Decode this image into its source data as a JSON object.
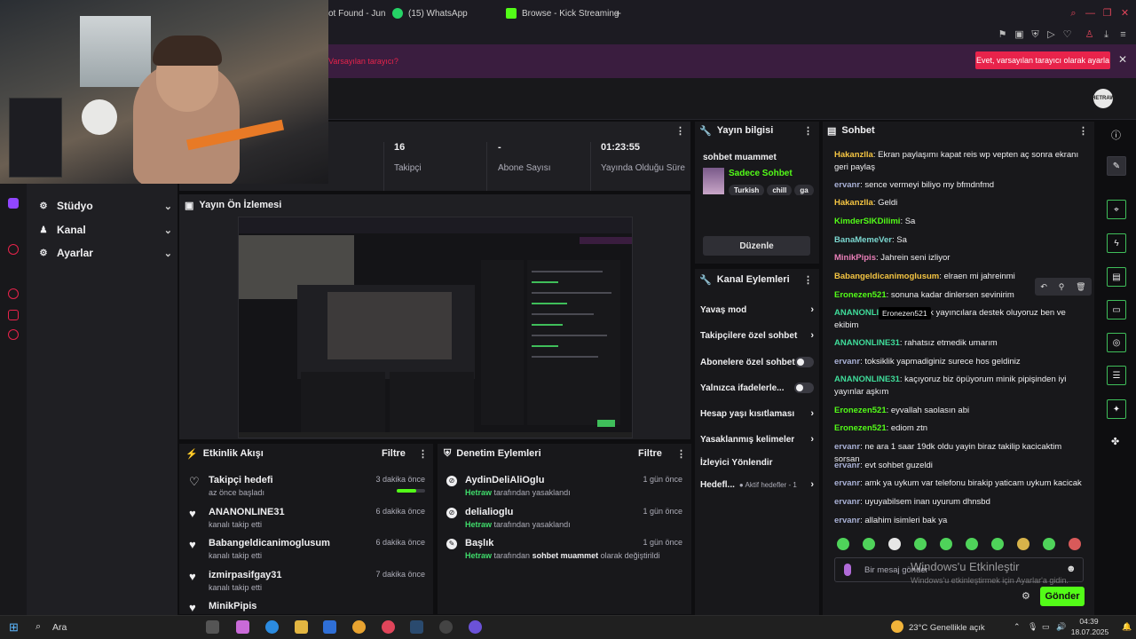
{
  "browser": {
    "tabs": [
      {
        "label": "ot Found - Jun",
        "icon": "page-icon"
      },
      {
        "label": "(15) WhatsApp",
        "icon": "whatsapp-icon"
      },
      {
        "label": "Browse - Kick Streaming",
        "icon": "kick-icon"
      }
    ],
    "new_tab": "+",
    "notify_text": "Varsayılan tarayıcı?",
    "notify_button": "Evet, varsayılan tarayıcı olarak ayarla",
    "notify_close": "✕"
  },
  "header": {
    "avatar_text": "HETRAW"
  },
  "nav": [
    {
      "label": "Stüdyo",
      "icon": "studio-icon"
    },
    {
      "label": "Kanal",
      "icon": "channel-icon"
    },
    {
      "label": "Ayarlar",
      "icon": "gear-icon"
    }
  ],
  "stats": [
    {
      "value": "",
      "label": ""
    },
    {
      "value": "16",
      "label": "Takipçi"
    },
    {
      "value": "-",
      "label": "Abone Sayısı"
    },
    {
      "value": "01:23:55",
      "label": "Yayında Olduğu Süre"
    }
  ],
  "preview": {
    "title": "Yayın Ön İzlemesi"
  },
  "activity": {
    "title": "Etkinlik Akışı",
    "filter": "Filtre",
    "items": [
      {
        "name": "Takipçi hedefi",
        "sub": "az önce başladı",
        "time": "3 dakika önce",
        "progress": 0.7
      },
      {
        "name": "ANANONLINE31",
        "sub": "kanalı takip etti",
        "time": "6 dakika önce"
      },
      {
        "name": "Babangeldicanimoglusum",
        "sub": "kanalı takip etti",
        "time": "6 dakika önce"
      },
      {
        "name": "izmirpasifgay31",
        "sub": "kanalı takip etti",
        "time": "7 dakika önce"
      },
      {
        "name": "MinikPipis",
        "sub": "",
        "time": ""
      }
    ]
  },
  "mod": {
    "title": "Denetim Eylemleri",
    "filter": "Filtre",
    "items": [
      {
        "name": "AydinDeliAliOglu",
        "actor": "Hetraw",
        "action": "tarafından yasaklandı",
        "target": "",
        "suffix": "",
        "time": "1 gün önce"
      },
      {
        "name": "delialioglu",
        "actor": "Hetraw",
        "action": "tarafından yasaklandı",
        "target": "",
        "suffix": "",
        "time": "1 gün önce"
      },
      {
        "name": "Başlık",
        "actor": "Hetraw",
        "action": "tarafından",
        "target": "sohbet muammet",
        "suffix": "olarak değiştirildi",
        "time": "1 gün önce"
      }
    ]
  },
  "streaminfo": {
    "title": "Yayın bilgisi",
    "stream_title": "sohbet muammet",
    "category": "Sadece Sohbet",
    "tags": [
      "Turkish",
      "chill",
      "ga"
    ],
    "edit_button": "Düzenle"
  },
  "channel_actions": {
    "title": "Kanal Eylemleri",
    "rows": [
      {
        "label": "Yavaş mod",
        "control": "chevron"
      },
      {
        "label": "Takipçilere özel sohbet",
        "control": "chevron"
      },
      {
        "label": "Abonelere özel sohbet",
        "control": "toggle"
      },
      {
        "label": "Yalnızca ifadelerle...",
        "control": "toggle"
      },
      {
        "label": "Hesap yaşı kısıtlaması",
        "control": "chevron"
      },
      {
        "label": "Yasaklanmış kelimeler",
        "control": "chevron"
      },
      {
        "label": "İzleyici Yönlendir",
        "control": "none"
      },
      {
        "label": "Hedefl...",
        "extra": "Aktif hedefler - 1",
        "control": "chevron"
      }
    ]
  },
  "chat": {
    "title": "Sohbet",
    "messages": [
      {
        "user": "Hakanzlla",
        "color": "#f5c542",
        "text": "Ekran paylaşımı kapat reis wp vepten aç sonra ekranı geri paylaş"
      },
      {
        "user": "ervanr",
        "color": "#a9b1d6",
        "text": "sence vermeyi biliyo my bfmdnfmd"
      },
      {
        "user": "Hakanzlla",
        "color": "#f5c542",
        "text": "Geldi"
      },
      {
        "user": "KimderSIKDilimi",
        "color": "#53fc18",
        "text": "Sa"
      },
      {
        "user": "BanaMemeVer",
        "color": "#7bd7d0",
        "text": "Sa"
      },
      {
        "user": "MinikPipis",
        "color": "#e97fb8",
        "text": "Jahrein seni izliyor"
      },
      {
        "user": "Babangeldicanimoglusum",
        "color": "#f5c542",
        "text": "elraen mi jahreinmi"
      },
      {
        "user": "Eronezen521",
        "color": "#53fc18",
        "text": "sonuna kadar dinlersen sevinirim"
      },
      {
        "user": "ANANONLINE31",
        "color": "#3fdc9a",
        "text": "a küçük yayıncılara destek oluyoruz ben ve ekibim"
      },
      {
        "user": "ANANONLINE31",
        "color": "#3fdc9a",
        "text": "rahatsız etmedik umarım"
      },
      {
        "user": "ervanr",
        "color": "#a9b1d6",
        "text": "toksiklik yapmadiginiz surece hos geldiniz"
      },
      {
        "user": "ANANONLINE31",
        "color": "#3fdc9a",
        "text": "kaçıyoruz biz öpüyorum minik pipişinden iyi yayınlar aşkım"
      },
      {
        "user": "Eronezen521",
        "color": "#53fc18",
        "text": "eyvallah saolasın abi"
      },
      {
        "user": "Eronezen521",
        "color": "#53fc18",
        "text": "ediom ztn"
      },
      {
        "user": "ervanr",
        "color": "#a9b1d6",
        "text": "ne ara 1 saar 19dk oldu yayin biraz takilip kacicaktim sorsan"
      },
      {
        "user": "ervanr",
        "color": "#a9b1d6",
        "text": "evt sohbet guzeldi"
      },
      {
        "user": "ervanr",
        "color": "#a9b1d6",
        "text": "amk ya uykum var telefonu birakip yaticam uykum kacicak"
      },
      {
        "user": "ervanr",
        "color": "#a9b1d6",
        "text": "uyuyabilsem inan uyurum dhnsbd"
      },
      {
        "user": "ervanr",
        "color": "#a9b1d6",
        "text": "allahim isimleri bak ya"
      }
    ],
    "tooltip": "Eronezen521",
    "input_placeholder": "Bir mesaj gönder",
    "send": "Gönder"
  },
  "watermark": {
    "title": "Windows'u Etkinleştir",
    "sub": "Windows'u etkinleştirmek için Ayarlar'a gidin."
  },
  "taskbar": {
    "search": "Ara",
    "weather": "23°C  Genellikle açık",
    "time": "04:39",
    "date": "18.07.2025"
  },
  "colors": {
    "accent": "#53fc18",
    "brand_red": "#e8234b",
    "panel": "#18181b"
  }
}
